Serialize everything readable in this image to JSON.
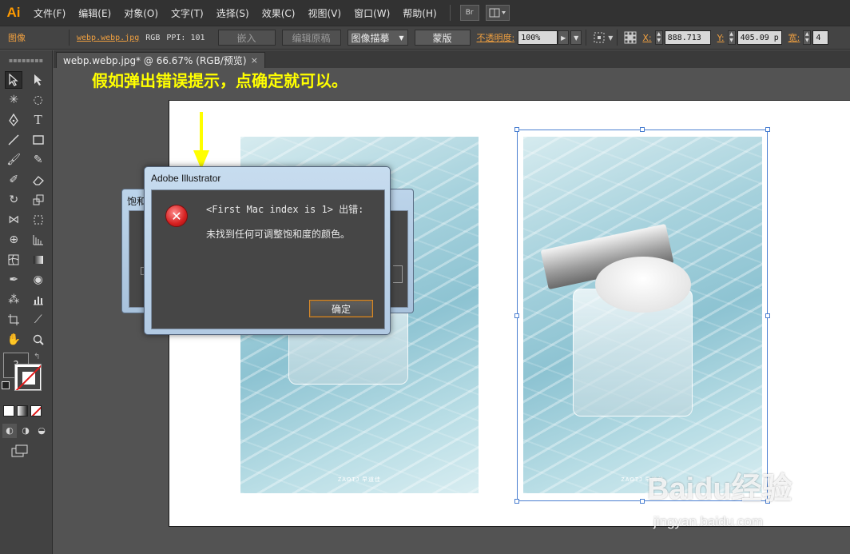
{
  "app": {
    "logo": "Ai"
  },
  "menu": {
    "items": [
      "文件(F)",
      "编辑(E)",
      "对象(O)",
      "文字(T)",
      "选择(S)",
      "效果(C)",
      "视图(V)",
      "窗口(W)",
      "帮助(H)"
    ],
    "bridge_label": "Br"
  },
  "control": {
    "object_type": "图像",
    "file_link": "webp.webp.jpg",
    "color_mode": "RGB",
    "ppi_label": "PPI: 101",
    "embed_label": "嵌入",
    "edit_original_label": "编辑原稿",
    "image_trace_label": "图像描摹",
    "mask_label": "蒙版",
    "opacity_label": "不透明度:",
    "opacity_value": "100%",
    "x_label": "X:",
    "x_value": "888.713",
    "y_label": "Y:",
    "y_value": "405.09 p",
    "width_label": "宽:",
    "width_value": "4"
  },
  "document": {
    "tab_title": "webp.webp.jpg* @ 66.67% (RGB/预览)",
    "close_symbol": "×"
  },
  "annotation": {
    "text": "假如弹出错误提示，点确定就可以。"
  },
  "background_dialog": {
    "title": "饱和"
  },
  "error_dialog": {
    "title": "Adobe Illustrator",
    "line1": "<First Mac index is 1> 出错:",
    "line2": "未找到任何可调整饱和度的颜色。",
    "ok_label": "确定"
  },
  "watermark": {
    "logo": "Baidu经验",
    "url": "jingyan.baidu.com"
  },
  "artwork": {
    "brand_text": "ZAOTJ 早道佳"
  },
  "colors": {
    "accent_orange": "#f0a040",
    "annotation_yellow": "#ffff00",
    "selection_blue": "#4a7fd1"
  }
}
